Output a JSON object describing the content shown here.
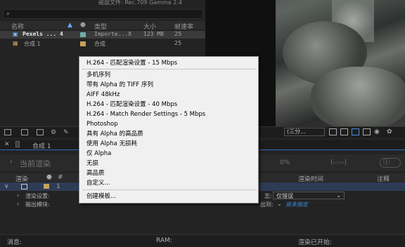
{
  "project": {
    "header_text": "磁盘文件: Rec.709 Gamma 2.4",
    "search_icon": "search-icon",
    "columns": [
      "名称",
      "类型",
      "大小",
      "帧速率"
    ],
    "rows": [
      {
        "name": "Pexels ... 4",
        "type": "Importe...X",
        "size": "123 MB",
        "fps": "25",
        "swatch": "#6fb0a8"
      },
      {
        "name": "合成 1",
        "type": "合成",
        "size": "",
        "fps": "25",
        "swatch": "#c7a25a"
      }
    ]
  },
  "viewer_toolbar": {
    "resolution": "(三分..."
  },
  "render_queue": {
    "comp_tab": "合成 1",
    "current_render": "当前渲染",
    "progress_percent": "0%",
    "eta": "(--:--)",
    "columns": [
      "渲染",
      "#",
      "渲染时间",
      "注释"
    ],
    "row_num": "1",
    "render_settings_label": "渲染设置:",
    "output_module_label": "输出模块:",
    "log_label": "志:",
    "log_value": "仅错误",
    "output_to_label": "出到:",
    "output_to_value": "尚未指定"
  },
  "status_bar": {
    "message_label": "消息:",
    "ram_label": "RAM:",
    "render_started_label": "渲染已开始:"
  },
  "menu": {
    "items": [
      "H.264 - 匹配渲染设置 - 15 Mbps",
      "多机序列",
      "带有 Alpha 的 TIFF 序列",
      "AIFF 48kHz",
      "H.264 - 匹配渲染设置 - 40 Mbps",
      "H.264 - Match Render Settings - 5 Mbps",
      "Photoshop",
      "具有 Alpha 的高品质",
      "使用 Alpha 无损耗",
      "仅 Alpha",
      "无损",
      "高品质",
      "自定义...",
      "创建模板..."
    ]
  }
}
